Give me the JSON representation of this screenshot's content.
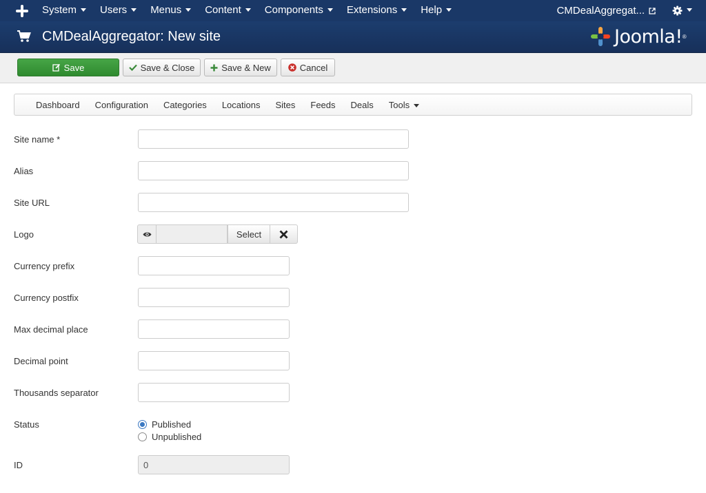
{
  "navbar": {
    "menu": [
      {
        "name": "nav-system",
        "label": "System"
      },
      {
        "name": "nav-users",
        "label": "Users"
      },
      {
        "name": "nav-menus",
        "label": "Menus"
      },
      {
        "name": "nav-content",
        "label": "Content"
      },
      {
        "name": "nav-components",
        "label": "Components"
      },
      {
        "name": "nav-extensions",
        "label": "Extensions"
      },
      {
        "name": "nav-help",
        "label": "Help"
      }
    ],
    "site_link": "CMDealAggregat...",
    "icons": {
      "logo": "joomla-icon",
      "external": "external-link-icon",
      "settings": "gear-icon"
    }
  },
  "header": {
    "title": "CMDealAggregator: New site",
    "icon": "cart-icon",
    "brand": "Joomla!",
    "brand_mark": "®"
  },
  "toolbar": {
    "save_label": "Save",
    "save_close_label": "Save & Close",
    "save_new_label": "Save & New",
    "cancel_label": "Cancel"
  },
  "subnav": {
    "items": [
      "Dashboard",
      "Configuration",
      "Categories",
      "Locations",
      "Sites",
      "Feeds",
      "Deals"
    ],
    "tools_label": "Tools"
  },
  "form": {
    "site_name": {
      "label": "Site name *",
      "value": ""
    },
    "alias": {
      "label": "Alias",
      "value": ""
    },
    "site_url": {
      "label": "Site URL",
      "value": ""
    },
    "logo": {
      "label": "Logo",
      "select_label": "Select"
    },
    "currency_prefix": {
      "label": "Currency prefix",
      "value": ""
    },
    "currency_postfix": {
      "label": "Currency postfix",
      "value": ""
    },
    "max_decimal_place": {
      "label": "Max decimal place",
      "value": ""
    },
    "decimal_point": {
      "label": "Decimal point",
      "value": ""
    },
    "thousands_separator": {
      "label": "Thousands separator",
      "value": ""
    },
    "status": {
      "label": "Status",
      "options": [
        "Published",
        "Unpublished"
      ],
      "selected": "Published"
    },
    "id": {
      "label": "ID",
      "value": "0"
    }
  },
  "colors": {
    "navbar": "#1a3867",
    "header": "#1c3d6e",
    "save_button": "#46a546",
    "cancel_icon": "#c9302c",
    "check_icon": "#3a8a3a"
  }
}
